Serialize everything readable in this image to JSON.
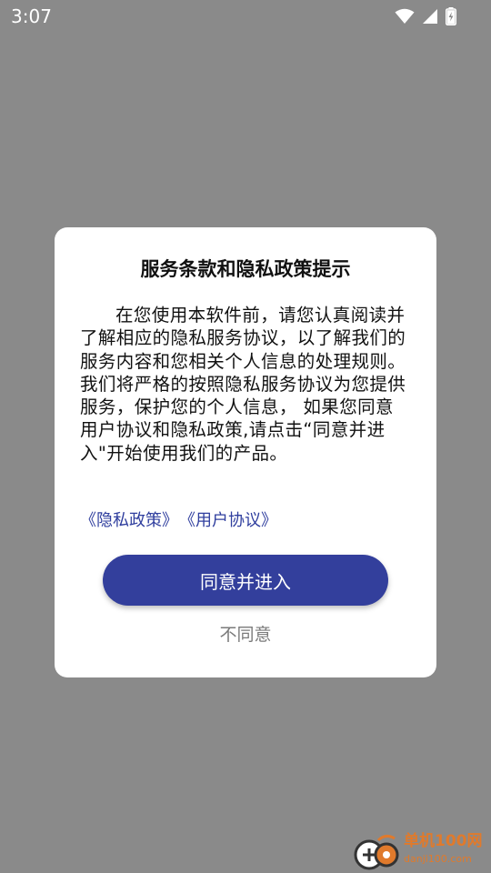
{
  "status_bar": {
    "time": "3:07",
    "icons": [
      "wifi-icon",
      "signal-icon",
      "battery-charging-icon"
    ]
  },
  "dialog": {
    "title": "服务条款和隐私政策提示",
    "body": "在您使用本软件前，请您认真阅读并了解相应的隐私服务协议，以了解我们的服务内容和您相关个人信息的处理规则。我们将严格的按照隐私服务协议为您提供服务，保护您的个人信息， 如果您同意用户协议和隐私政策,请点击“同意并进入\"开始使用我们的产品。",
    "links": {
      "privacy_policy": "《隐私政策》",
      "user_agreement": "《用户协议》"
    },
    "agree_label": "同意并进入",
    "disagree_label": "不同意"
  },
  "watermark": {
    "name": "单机100网",
    "url": "danji100.com"
  },
  "colors": {
    "overlay": "#8a8a8a",
    "primary_button": "#333f9c",
    "link": "#2f3e9e",
    "watermark": "#e07a2c"
  }
}
